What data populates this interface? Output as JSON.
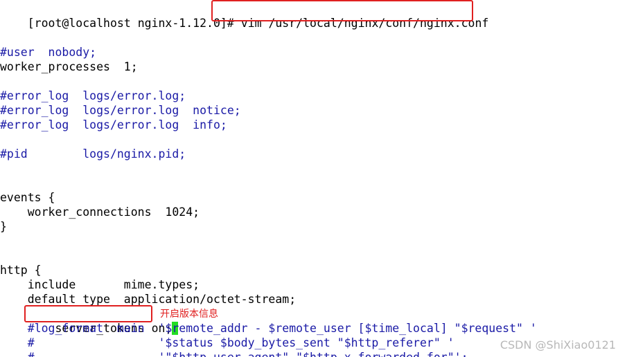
{
  "terminal": {
    "prompt": "[root@localhost nginx-1.12.0]# ",
    "command": "vim /usr/local/nginx/conf/nginx.conf",
    "lines": {
      "user": "#user  nobody;",
      "worker_processes": "worker_processes  1;",
      "error_log_1": "#error_log  logs/error.log;",
      "error_log_2": "#error_log  logs/error.log  notice;",
      "error_log_3": "#error_log  logs/error.log  info;",
      "pid": "#pid        logs/nginx.pid;",
      "events_open": "events {",
      "worker_connections": "    worker_connections  1024;",
      "events_close": "}",
      "http_open": "http {",
      "include": "    include       mime.types;",
      "default_type": "    default_type  application/octet-stream;",
      "server_tokens_indent": "    ",
      "server_tokens": "server_tokens on;",
      "log_format_1": "    #log_format  main  '$remote_addr - $remote_user [$time_local] \"$request\" '",
      "log_format_2": "    #                  '$status $body_bytes_sent \"$http_referer\" '",
      "log_format_3": "    #                  '\"$http_user_agent\" \"$http_x_forwarded_for\"';"
    }
  },
  "annotation": {
    "text": "开启版本信息"
  },
  "watermark": {
    "text": "CSDN @ShiXiao0121"
  },
  "colors": {
    "comment": "#1a1aa6",
    "highlight_box": "#e02020",
    "cursor": "#22dd22"
  }
}
